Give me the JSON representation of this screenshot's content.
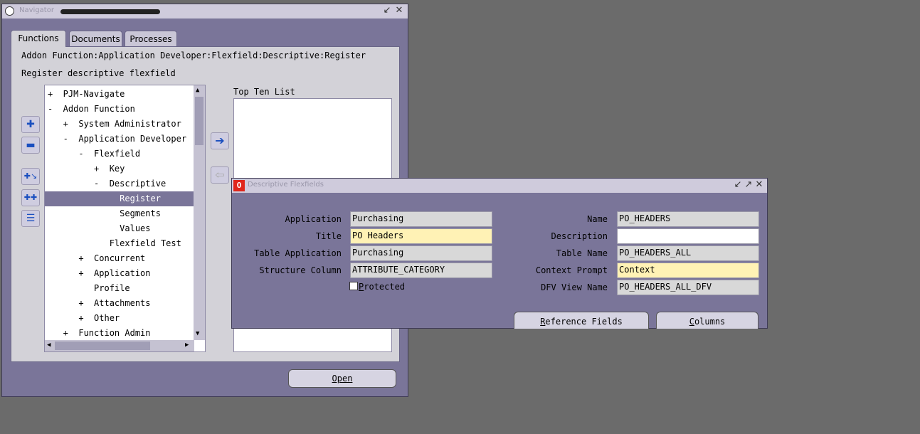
{
  "navigator": {
    "title": "Navigator",
    "tabs": [
      "Functions",
      "Documents",
      "Processes"
    ],
    "path": "Addon Function:Application Developer:Flexfield:Descriptive:Register",
    "description": "Register descriptive flexfield",
    "top_ten_label": "Top Ten List",
    "open_label": "Open",
    "tree": [
      {
        "label": "+  PJM-Navigate"
      },
      {
        "label": "-  Addon Function"
      },
      {
        "label": "   +  System Administrator"
      },
      {
        "label": "   -  Application Developer"
      },
      {
        "label": "      -  Flexfield"
      },
      {
        "label": "         +  Key"
      },
      {
        "label": "         -  Descriptive"
      },
      {
        "label": "              Register",
        "selected": true
      },
      {
        "label": "              Segments"
      },
      {
        "label": "              Values"
      },
      {
        "label": "            Flexfield Test"
      },
      {
        "label": "      +  Concurrent"
      },
      {
        "label": "      +  Application"
      },
      {
        "label": "         Profile"
      },
      {
        "label": "      +  Attachments"
      },
      {
        "label": "      +  Other"
      },
      {
        "label": "   +  Function Admin"
      }
    ]
  },
  "dialog": {
    "title": "Descriptive Flexfields",
    "labels": {
      "application": "Application",
      "title": "Title",
      "table_application": "Table Application",
      "structure_column": "Structure Column",
      "protected": "Protected",
      "name": "Name",
      "description": "Description",
      "table_name": "Table Name",
      "context_prompt": "Context Prompt",
      "dfv_view_name": "DFV View Name"
    },
    "values": {
      "application": "Purchasing",
      "title": "PO Headers",
      "table_application": "Purchasing",
      "structure_column": "ATTRIBUTE_CATEGORY",
      "name": "PO_HEADERS",
      "description": "",
      "table_name": "PO_HEADERS_ALL",
      "context_prompt": "Context",
      "dfv_view_name": "PO_HEADERS_ALL_DFV"
    },
    "protected_checked": false,
    "buttons": {
      "reference_fields": "Reference Fields",
      "columns": "Columns"
    }
  }
}
